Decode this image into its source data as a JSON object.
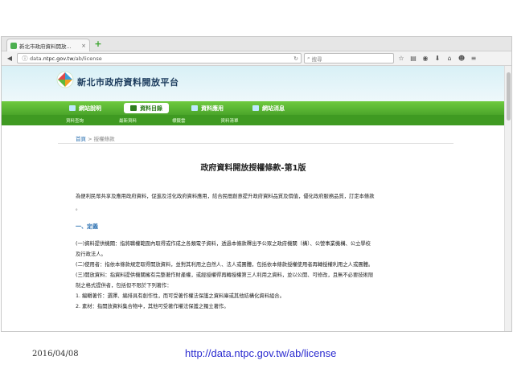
{
  "browser": {
    "tab_title": "新北市政府資料開放...",
    "tab_close": "×",
    "new_tab": "+",
    "url_prefix": "data.",
    "url_host": "ntpc.gov.tw",
    "url_path": "/ab/license",
    "search_placeholder": "搜尋",
    "icons": [
      "back-icon",
      "info-icon",
      "reload-icon",
      "search-icon",
      "star-icon",
      "bookmarks-icon",
      "pocket-icon",
      "download-icon",
      "home-icon",
      "chat-icon",
      "menu-icon"
    ]
  },
  "site": {
    "title": "新北市政府資料開放平台",
    "nav": [
      {
        "label": "網站說明",
        "active": false
      },
      {
        "label": "資料目錄",
        "active": true
      },
      {
        "label": "資料應用",
        "active": false
      },
      {
        "label": "網站消息",
        "active": false
      }
    ],
    "subnav": [
      "資料查詢",
      "最新資料",
      "標籤雲",
      "資料清單"
    ],
    "breadcrumb": {
      "home": "首頁",
      "separator": ">",
      "current": "授權條款"
    }
  },
  "document": {
    "title": "政府資料開放授權條款-第1版",
    "lead": "為便利民眾共享及應用政府資料，促進及活化政府資料應用，結合民間創意提升政府資料品質及價值，優化政府服務品質，訂定本條款",
    "dot": "。",
    "section_heading": "一、定義",
    "paragraphs": [
      "(一)資料提供機關：指將職權範圍內取得或作成之各類電子資料，透過本條款釋出予公眾之政府機關（構）、公營事業機構、公立學校",
      "及行政法人。",
      "(二)使用者：指依本條款規定取得開放資料，並對其利用之自然人、法人或團體，包括依本條款授權使用者再轉授權利用之人或團體。",
      "(三)開放資料：指資料提供機關擁有完整著作財產權，或經授權得再轉授權第三人利用之資料，並以公開、可修改，且無不必要技術限",
      "制之格式提供者，包括但不限於下列著作：",
      "1. 編輯著作：選擇、編排具有創作性，而可受著作權法保護之資料庫或其他結構化資料組合。",
      "2. 素材：指開放資料集合物中，其他可受著作權法保護之獨立著作。"
    ]
  },
  "slide": {
    "date": "2016/04/08",
    "url": "http://data.ntpc.gov.tw/ab/license"
  }
}
